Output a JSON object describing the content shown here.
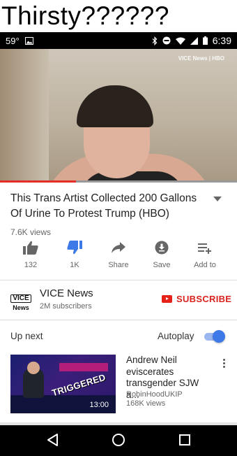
{
  "caption": {
    "text": "Thirsty??????"
  },
  "status_bar": {
    "temperature": "59°",
    "time": "6:39"
  },
  "video": {
    "watermark": "VICE News | HBO",
    "title": "This Trans Artist Collected 200 Gallons Of Urine To Protest Trump (HBO)",
    "views": "7.6K views",
    "progress_fraction": 0.32
  },
  "actions": [
    {
      "name": "like",
      "label": "132",
      "icon": "thumbs-up-icon"
    },
    {
      "name": "dislike",
      "label": "1K",
      "icon": "thumbs-down-icon",
      "active": true
    },
    {
      "name": "share",
      "label": "Share",
      "icon": "share-icon"
    },
    {
      "name": "save",
      "label": "Save",
      "icon": "download-icon"
    },
    {
      "name": "add-to",
      "label": "Add to",
      "icon": "playlist-add-icon"
    }
  ],
  "channel": {
    "logo_line1": "VICE",
    "logo_line2": "News",
    "name": "VICE News",
    "subscribers": "2M subscribers",
    "subscribe_label": "SUBSCRIBE"
  },
  "up_next": {
    "label": "Up next",
    "autoplay_label": "Autoplay",
    "autoplay_on": true
  },
  "recommendation": {
    "title": "Andrew Neil eviscerates transgender SJW a...",
    "channel": "RobinHoodUKIP",
    "views": "168K views",
    "duration": "13:00",
    "thumbnail_text": "TRIGGERED"
  },
  "colors": {
    "accent_red": "#e62117",
    "active_blue": "#3e79e8",
    "status_bar": "#000000"
  }
}
